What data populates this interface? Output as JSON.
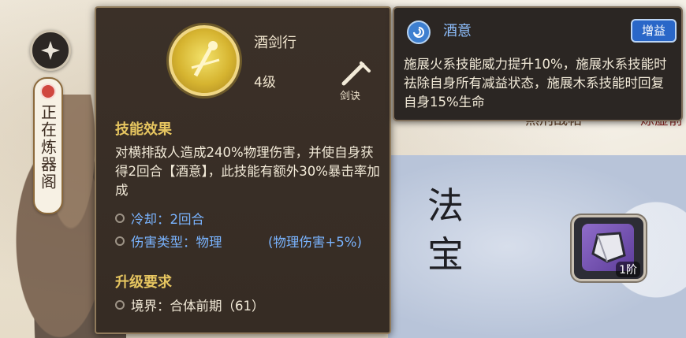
{
  "skill": {
    "name": "酒剑行",
    "level": "4级",
    "type_label": "剑诀",
    "effect_title": "技能效果",
    "description": "对横排敌人造成240%物理伤害，并使自身获得2回合【酒意】，此技能有额外30%暴击率加成",
    "cooldown": "冷却：2回合",
    "damage_type": "伤害类型：物理",
    "damage_bonus": "(物理伤害+5%)",
    "upgrade_title": "升级要求",
    "realm_requirement": "境界：合体前期（61）"
  },
  "buff": {
    "name": "酒意",
    "tag": "增益",
    "description": "施展火系技能威力提升10%，施展水系技能时祛除自身所有减益状态，施展木系技能时回复自身15%生命"
  },
  "background": {
    "status_text": "正在炼器阁",
    "fabao_title": "法宝",
    "item_tier": "1阶",
    "button_left": "煞刑战帖",
    "button_right": "炼虚前"
  },
  "colors": {
    "accent_gold": "#e7c660",
    "link_blue": "#7ab4ff",
    "panel_bg": "#3a2f27"
  }
}
